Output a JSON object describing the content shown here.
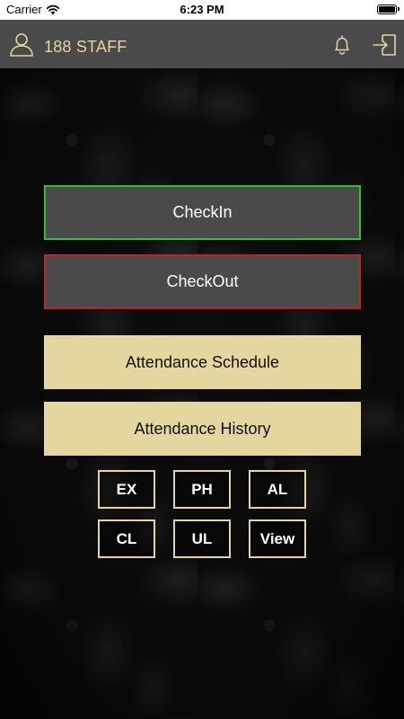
{
  "status_bar": {
    "carrier": "Carrier",
    "time": "6:23 PM"
  },
  "header": {
    "title": "188 STAFF",
    "icons": [
      "user-icon",
      "bell-icon",
      "logout-icon"
    ]
  },
  "colors": {
    "header_bg": "#4a4a4a",
    "gold": "#e3d69f",
    "checkin_border": "#2fc12f",
    "checkout_border": "#c02323"
  },
  "actions": {
    "checkin": "CheckIn",
    "checkout": "CheckOut",
    "schedule": "Attendance Schedule",
    "history": "Attendance History"
  },
  "quick_buttons": [
    "EX",
    "PH",
    "AL",
    "CL",
    "UL",
    "View"
  ]
}
